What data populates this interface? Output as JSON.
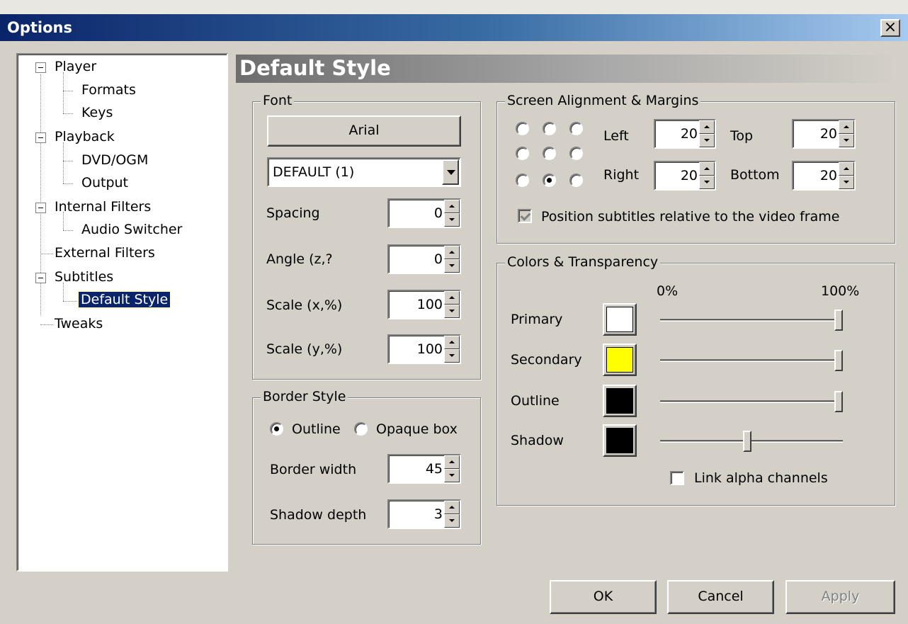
{
  "window": {
    "title": "Options",
    "close_glyph": "×"
  },
  "tree": {
    "items": [
      {
        "label": "Player",
        "level": 0,
        "expanded": true
      },
      {
        "label": "Formats",
        "level": 1
      },
      {
        "label": "Keys",
        "level": 1
      },
      {
        "label": "Playback",
        "level": 0,
        "expanded": true
      },
      {
        "label": "DVD/OGM",
        "level": 1
      },
      {
        "label": "Output",
        "level": 1
      },
      {
        "label": "Internal Filters",
        "level": 0,
        "expanded": true
      },
      {
        "label": "Audio Switcher",
        "level": 1
      },
      {
        "label": "External Filters",
        "level": 0
      },
      {
        "label": "Subtitles",
        "level": 0,
        "expanded": true
      },
      {
        "label": "Default Style",
        "level": 1,
        "selected": true
      },
      {
        "label": "Tweaks",
        "level": 0
      }
    ]
  },
  "page_header": "Default Style",
  "font_group": {
    "label": "Font",
    "font_button": "Arial",
    "charset_value": "DEFAULT (1)",
    "spacing_label": "Spacing",
    "spacing_value": "0",
    "angle_label": "Angle (z,?",
    "angle_value": "0",
    "scale_x_label": "Scale (x,%)",
    "scale_x_value": "100",
    "scale_y_label": "Scale (y,%)",
    "scale_y_value": "100"
  },
  "border_group": {
    "label": "Border Style",
    "outline_label": "Outline",
    "outline_selected": true,
    "opaque_label": "Opaque box",
    "width_label": "Border width",
    "width_value": "45",
    "shadow_label": "Shadow depth",
    "shadow_value": "3"
  },
  "alignment_group": {
    "label": "Screen Alignment & Margins",
    "selected_position": "bottom-center",
    "left_label": "Left",
    "left_value": "20",
    "top_label": "Top",
    "top_value": "20",
    "right_label": "Right",
    "right_value": "20",
    "bottom_label": "Bottom",
    "bottom_value": "20",
    "relative_label": "Position subtitles relative to the video frame",
    "relative_checked": true
  },
  "colors_group": {
    "label": "Colors & Transparency",
    "min_label": "0%",
    "max_label": "100%",
    "rows": [
      {
        "label": "Primary",
        "color": "#ffffff",
        "alpha_fraction": 1.0
      },
      {
        "label": "Secondary",
        "color": "#ffff00",
        "alpha_fraction": 1.0
      },
      {
        "label": "Outline",
        "color": "#000000",
        "alpha_fraction": 1.0
      },
      {
        "label": "Shadow",
        "color": "#000000",
        "alpha_fraction": 0.5
      }
    ],
    "link_label": "Link alpha channels",
    "link_checked": false
  },
  "buttons": {
    "ok": "OK",
    "cancel": "Cancel",
    "apply": "Apply"
  }
}
